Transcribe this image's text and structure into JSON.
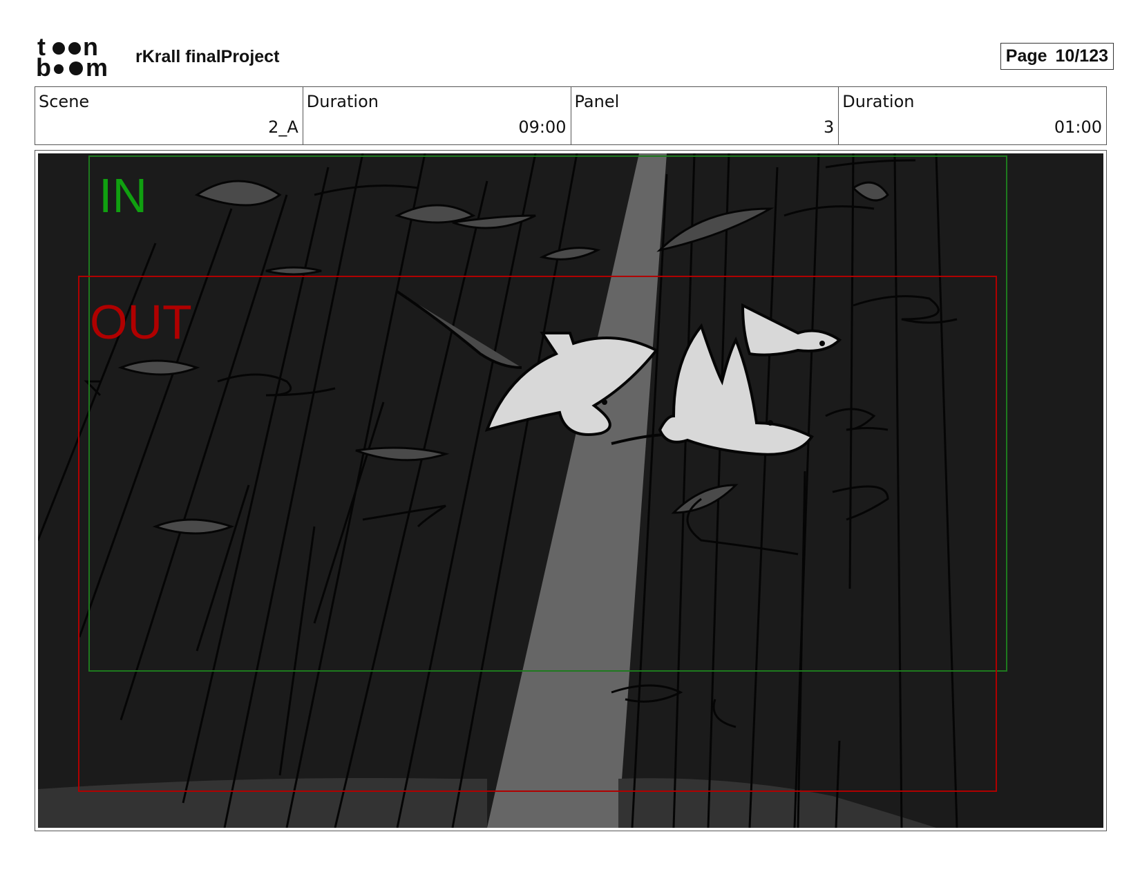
{
  "header": {
    "logo_text_top": "toon",
    "logo_text_bottom": "boom",
    "project_title": "rKrall finalProject",
    "page_label": "Page",
    "page_number": "10/123"
  },
  "info": {
    "scene_label": "Scene",
    "scene_value": "2_A",
    "scene_duration_label": "Duration",
    "scene_duration_value": "09:00",
    "panel_label": "Panel",
    "panel_value": "3",
    "panel_duration_label": "Duration",
    "panel_duration_value": "01:00"
  },
  "panel": {
    "in_label": "IN",
    "out_label": "OUT",
    "colors": {
      "background": "#1b1b1b",
      "light_beam": "#666666",
      "ground": "#333333",
      "birds": "#d8d8d8",
      "in_frame": "#1e7a1e",
      "out_frame": "#b00000"
    }
  }
}
